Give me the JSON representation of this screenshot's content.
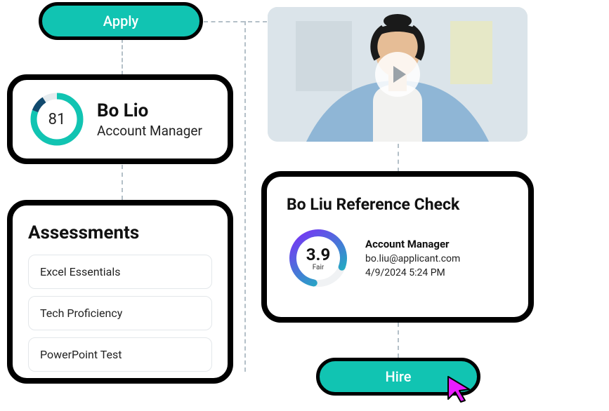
{
  "apply_label": "Apply",
  "hire_label": "Hire",
  "colors": {
    "accent": "#11c4b2",
    "ring_bg": "#e6ecef",
    "ring_secondary": "#114a6e",
    "grad_start": "#7b2ff7",
    "grad_end": "#12c2b8"
  },
  "profile": {
    "score": "81",
    "name": "Bo Lio",
    "role": "Account Manager"
  },
  "assessments": {
    "title": "Assessments",
    "items": [
      "Excel Essentials",
      "Tech Proficiency",
      "PowerPoint Test"
    ]
  },
  "reference": {
    "title": "Bo Liu Reference Check",
    "rating_value": "3.9",
    "rating_word": "Fair",
    "role": "Account Manager",
    "email": "bo.liu@applicant.com",
    "datetime": "4/9/2024  5:24 PM"
  }
}
